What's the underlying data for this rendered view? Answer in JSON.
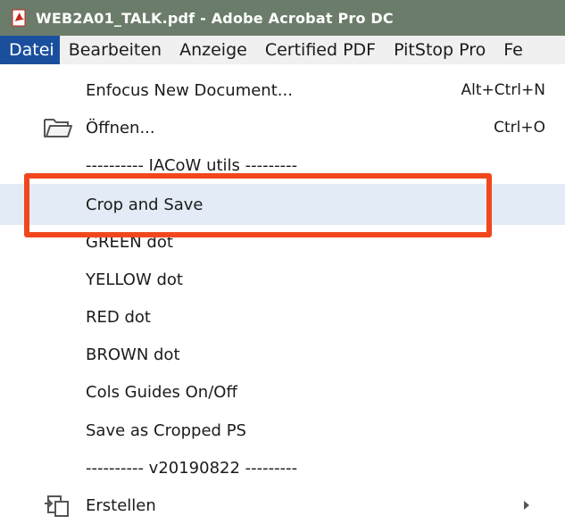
{
  "window": {
    "title": "WEB2A01_TALK.pdf - Adobe Acrobat Pro DC",
    "title_bar_color": "#6b7d6a",
    "app_icon": "pdf-icon"
  },
  "menubar": {
    "items": [
      {
        "label": "Datei",
        "active": true
      },
      {
        "label": "Bearbeiten"
      },
      {
        "label": "Anzeige"
      },
      {
        "label": "Certified PDF"
      },
      {
        "label": "PitStop Pro"
      },
      {
        "label": "Fe"
      }
    ],
    "active_color": "#1a4f9e"
  },
  "dropdown": {
    "items": [
      {
        "label": "Enfocus New Document...",
        "shortcut": "Alt+Ctrl+N"
      },
      {
        "label": "Öffnen...",
        "shortcut": "Ctrl+O",
        "icon": "folder-open-icon"
      },
      {
        "label": "---------- IACoW utils ---------",
        "separator": true
      },
      {
        "label": "Crop and Save",
        "highlighted": true
      },
      {
        "label": "GREEN dot"
      },
      {
        "label": "YELLOW dot"
      },
      {
        "label": "RED dot"
      },
      {
        "label": "BROWN dot"
      },
      {
        "label": "Cols Guides On/Off"
      },
      {
        "label": "Save as Cropped PS"
      },
      {
        "label": "---------- v20190822 ---------",
        "separator": true
      },
      {
        "label": "Erstellen",
        "icon": "create-pdf-icon",
        "submenu": true
      }
    ],
    "highlight_color": "#e3ecf6"
  },
  "annotation": {
    "color": "#f1471d",
    "target": "Crop and Save"
  }
}
